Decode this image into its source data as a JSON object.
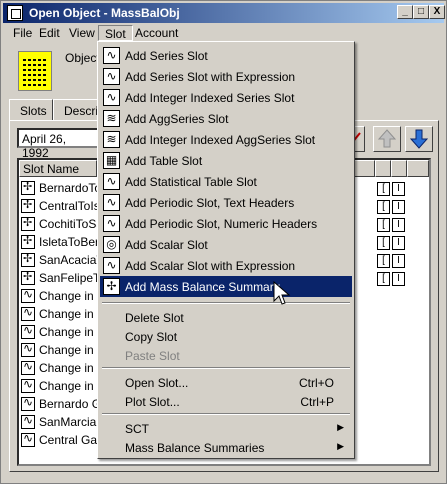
{
  "window": {
    "title": "Open Object - MassBalObj",
    "controls": [
      "_",
      "□",
      "X"
    ]
  },
  "menubar": {
    "items": [
      {
        "label": "File"
      },
      {
        "label": "Edit"
      },
      {
        "label": "View"
      },
      {
        "label": "Slot"
      },
      {
        "label": "Account"
      }
    ]
  },
  "header": {
    "object_label": "Object"
  },
  "tabs": [
    "Slots",
    "Descrip"
  ],
  "toolbar": {
    "date": "April 26, 1992"
  },
  "table": {
    "column_header": "Slot Name",
    "rows": [
      {
        "label": "BernardoToS",
        "icon": "mass-balance"
      },
      {
        "label": "CentralToIsle",
        "icon": "mass-balance"
      },
      {
        "label": "CochitiToSan",
        "icon": "mass-balance"
      },
      {
        "label": "IsletaToBern",
        "icon": "mass-balance"
      },
      {
        "label": "SanAcaciaTo",
        "icon": "mass-balance"
      },
      {
        "label": "SanFelipeTo",
        "icon": "mass-balance"
      },
      {
        "label": "Change in St",
        "icon": "series"
      },
      {
        "label": "Change in St",
        "icon": "series"
      },
      {
        "label": "Change in St",
        "icon": "series"
      },
      {
        "label": "Change in St",
        "icon": "series"
      },
      {
        "label": "Change in St",
        "icon": "series"
      },
      {
        "label": "Change in St",
        "icon": "series"
      },
      {
        "label": "Bernardo Ga",
        "icon": "series"
      },
      {
        "label": "SanMarcialFl",
        "icon": "series"
      },
      {
        "label": "Central Gage",
        "icon": "series"
      }
    ],
    "flag_marks": [
      "[",
      "I"
    ]
  },
  "slot_menu": {
    "items": [
      {
        "type": "item",
        "label": "Add Series Slot",
        "icon": "series-icon"
      },
      {
        "type": "item",
        "label": "Add Series Slot with Expression",
        "icon": "series-expression-icon"
      },
      {
        "type": "item",
        "label": "Add Integer Indexed Series Slot",
        "icon": "integer-series-icon"
      },
      {
        "type": "item",
        "label": "Add AggSeries Slot",
        "icon": "agg-series-icon"
      },
      {
        "type": "item",
        "label": "Add Integer Indexed AggSeries Slot",
        "icon": "integer-agg-series-icon"
      },
      {
        "type": "item",
        "label": "Add Table Slot",
        "icon": "table-icon"
      },
      {
        "type": "item",
        "label": "Add Statistical Table Slot",
        "icon": "statistical-table-icon"
      },
      {
        "type": "item",
        "label": "Add Periodic Slot, Text Headers",
        "icon": "periodic-text-icon"
      },
      {
        "type": "item",
        "label": "Add Periodic Slot, Numeric Headers",
        "icon": "periodic-numeric-icon"
      },
      {
        "type": "item",
        "label": "Add Scalar Slot",
        "icon": "scalar-icon"
      },
      {
        "type": "item",
        "label": "Add Scalar Slot with Expression",
        "icon": "scalar-expression-icon"
      },
      {
        "type": "item",
        "label": "Add Mass Balance Summary",
        "icon": "mass-balance-icon",
        "selected": true
      },
      {
        "type": "separator"
      },
      {
        "type": "item",
        "label": "Delete Slot"
      },
      {
        "type": "item",
        "label": "Copy Slot"
      },
      {
        "type": "item",
        "label": "Paste Slot",
        "disabled": true
      },
      {
        "type": "separator"
      },
      {
        "type": "item",
        "label": "Open Slot...",
        "shortcut": "Ctrl+O"
      },
      {
        "type": "item",
        "label": "Plot Slot...",
        "shortcut": "Ctrl+P"
      },
      {
        "type": "separator"
      },
      {
        "type": "item",
        "label": "SCT",
        "submenu": true
      },
      {
        "type": "item",
        "label": "Mass Balance Summaries",
        "submenu": true
      }
    ]
  },
  "colors": {
    "title_gradient_start": "#0a246a",
    "title_gradient_end": "#a6caf0",
    "menu_highlight": "#0a246a",
    "face": "#d4d0c8",
    "arrow_blue": "#2a6fd6"
  }
}
